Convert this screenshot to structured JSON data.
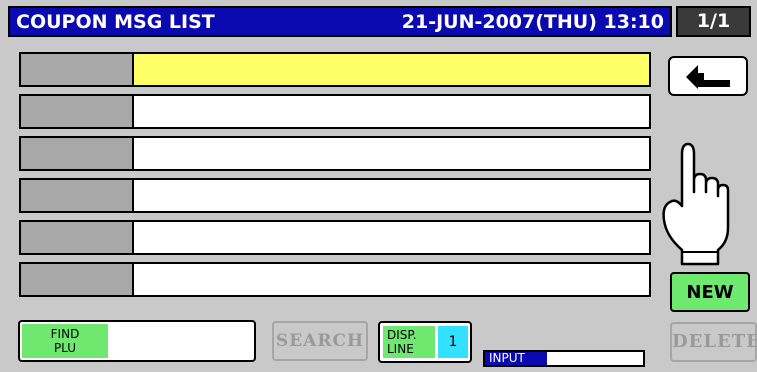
{
  "header": {
    "title": "COUPON MSG LIST",
    "datetime": "21-JUN-2007(THU) 13:10",
    "page": "1/1"
  },
  "list": {
    "rows": [
      {
        "number": "",
        "text": "",
        "selected": true
      },
      {
        "number": "",
        "text": "",
        "selected": false
      },
      {
        "number": "",
        "text": "",
        "selected": false
      },
      {
        "number": "",
        "text": "",
        "selected": false
      },
      {
        "number": "",
        "text": "",
        "selected": false
      },
      {
        "number": "",
        "text": "",
        "selected": false
      }
    ]
  },
  "buttons": {
    "back_icon": "return-arrow-icon",
    "new_label": "NEW",
    "delete_label": "DELETE",
    "search_label": "SEARCH"
  },
  "find_plu": {
    "label_line1": "FIND",
    "label_line2": "PLU",
    "value": ""
  },
  "disp_line": {
    "label_line1": "DISP.",
    "label_line2": "LINE",
    "value": "1"
  },
  "input_indicator": {
    "label": "INPUT",
    "value": ""
  },
  "pointer": {
    "icon": "pointing-hand-icon"
  },
  "colors": {
    "header_bg": "#0a0ab0",
    "selected_row": "#ffff66",
    "green_button": "#6fe86f",
    "cyan_value": "#33e0ff"
  }
}
